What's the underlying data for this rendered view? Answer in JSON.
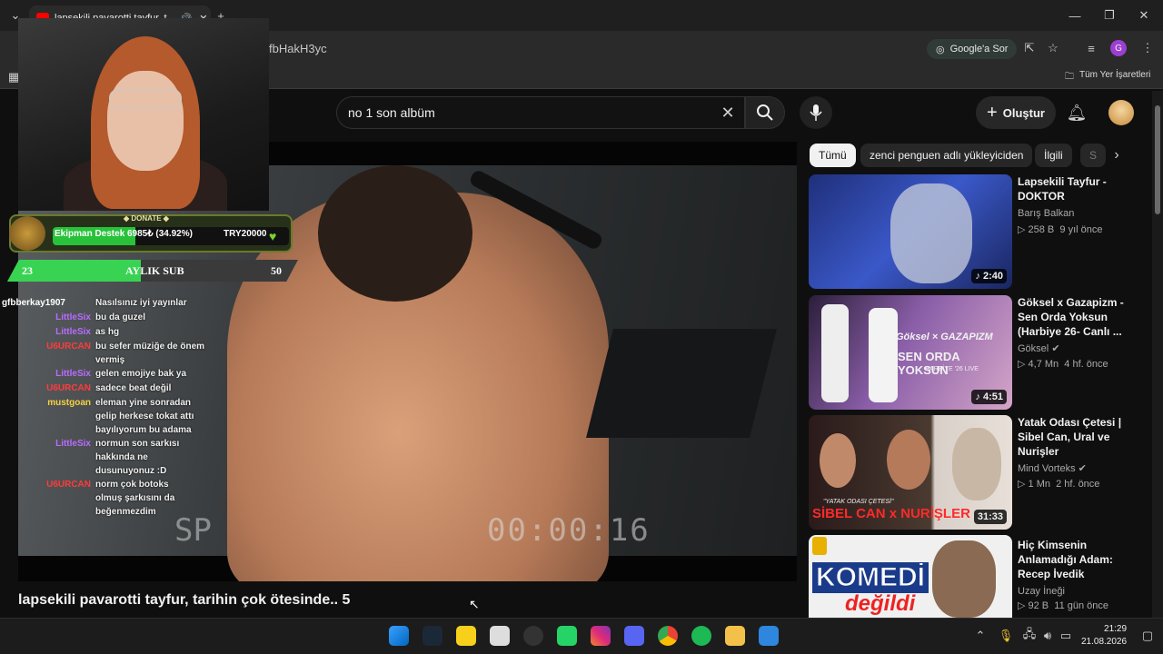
{
  "browser": {
    "tab_title": "lapsekili pavarotti tayfur, t",
    "url": "fbHakH3yc",
    "google_ask": "Google'a Sor",
    "bookmarks_all": "Tüm Yer İşaretleri",
    "profile_letter": "G"
  },
  "youtube": {
    "search_value": "no 1 son albüm",
    "create_label": "Oluştur",
    "video_title": "lapsekili pavarotti tayfur, tarihin çok ötesinde.. 5",
    "timecode": "00:00:16",
    "sp_label": "SP",
    "chips": [
      "Tümü",
      "zenci penguen adlı yükleyiciden",
      "İlgili",
      "S"
    ],
    "recommendations": [
      {
        "title": "Lapsekili Tayfur - DOKTOR",
        "channel": "Barış Balkan",
        "views": "258 B",
        "age": "9 yıl önce",
        "duration": "2:40",
        "verified": false
      },
      {
        "title": "Göksel x Gazapizm - Sen Orda Yoksun (Harbiye 26- Canlı ...",
        "channel": "Göksel",
        "views": "4,7 Mn",
        "age": "4 hf. önce",
        "duration": "4:51",
        "verified": true,
        "thumb_text": "SEN ORDA YOKSUN",
        "thumb_sub": "HARBİYE '26 LIVE",
        "thumb_brand": "Göksel × GAZAPIZM"
      },
      {
        "title": "Yatak Odası Çetesi | Sibel Can, Ural ve Nurişler",
        "channel": "Mind Vorteks",
        "views": "1 Mn",
        "age": "2 hf. önce",
        "duration": "31:33",
        "verified": true,
        "thumb_text": "SİBEL CAN x NURİŞLER",
        "thumb_sub": "\"YATAK ODASI ÇETESİ\""
      },
      {
        "title": "Hiç Kimsenin Anlamadığı Adam: Recep İvedik",
        "channel": "Uzay İneği",
        "views": "92 B",
        "age": "11 gün önce",
        "duration": "",
        "verified": false,
        "thumb_text": "KOMEDİ",
        "thumb_sub": "değildi"
      }
    ]
  },
  "overlay": {
    "donate_label": "DONATE",
    "donate_name": "Ekipman Destek",
    "donate_amount": "6985₺ (34.92%)",
    "donate_goal": "TRY20000",
    "donate_progress": 0.3492,
    "sub_left": "23",
    "sub_label": "AYLIK SUB",
    "sub_right": "50",
    "sub_progress": 0.46,
    "chat": [
      {
        "user": "",
        "text": "Nasılsınız iyi yayınlar",
        "color": "#ffffff",
        "pre_user": "gfbberkay1907"
      },
      {
        "user": "LittleSix",
        "text": "bu da guzel",
        "color": "#b86cff"
      },
      {
        "user": "LittleSix",
        "text": "as hg",
        "color": "#b86cff"
      },
      {
        "user": "U6URCAN",
        "text": "bu sefer müziğe de önem vermiş",
        "color": "#ff3b3b"
      },
      {
        "user": "LittleSix",
        "text": "gelen emojiye bak ya",
        "color": "#b86cff"
      },
      {
        "user": "U6URCAN",
        "text": "sadece beat değil",
        "color": "#ff3b3b"
      },
      {
        "user": "mustgoan",
        "text": "eleman yine sonradan gelip herkese tokat attı bayılıyorum bu adama",
        "color": "#f5d142"
      },
      {
        "user": "LittleSix",
        "text": "normun son sarkısı hakkında ne dusunuyonuz :D",
        "color": "#b86cff"
      },
      {
        "user": "U6URCAN",
        "text": "norm çok botoks olmuş şarkısını da beğenmezdim",
        "color": "#ff3b3b"
      }
    ]
  },
  "taskbar": {
    "time": "21:29",
    "date": "21.08.2026"
  }
}
